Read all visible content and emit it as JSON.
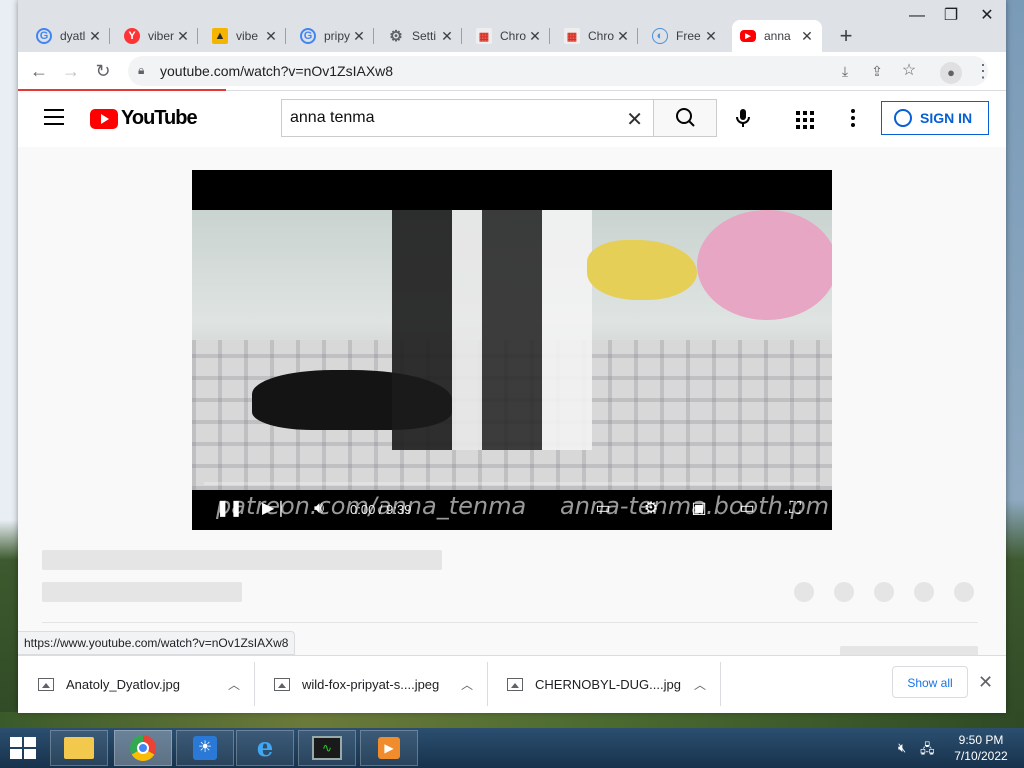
{
  "tabs": [
    {
      "title": "dyatl",
      "icon": "google-icon",
      "color": "#4285f4"
    },
    {
      "title": "viber",
      "icon": "yandex-icon",
      "color": "#ff3333"
    },
    {
      "title": "vibe",
      "icon": "image-icon",
      "color": "#e8a100"
    },
    {
      "title": "pripy",
      "icon": "google-icon",
      "color": "#4285f4"
    },
    {
      "title": "Setti",
      "icon": "gear-icon",
      "color": "#5f6368"
    },
    {
      "title": "Chro",
      "icon": "chrome-store-icon",
      "color": "#d93025"
    },
    {
      "title": "Chro",
      "icon": "chrome-store-icon",
      "color": "#d93025"
    },
    {
      "title": "Free",
      "icon": "blue-circle-icon",
      "color": "#4a90d9"
    },
    {
      "title": "anna",
      "icon": "youtube-icon",
      "color": "#ff0000",
      "active": true
    }
  ],
  "omnibox": {
    "url": "youtube.com/watch?v=nOv1ZsIAXw8"
  },
  "youtube": {
    "logo_text": "YouTube",
    "search_value": "anna tenma",
    "signin_label": "SIGN IN"
  },
  "video": {
    "time": "0:00 / 9:39",
    "watermark_left": "patreon.com/anna_tenma",
    "watermark_right": "anna-tenma.booth.pm",
    "progress": 0
  },
  "status_url": "https://www.youtube.com/watch?v=nOv1ZsIAXw8",
  "downloads": [
    {
      "name": "Anatoly_Dyatlov.jpg"
    },
    {
      "name": "wild-fox-pripyat-s....jpeg"
    },
    {
      "name": "CHERNOBYL-DUG....jpg"
    }
  ],
  "shelf": {
    "show_all": "Show all"
  },
  "taskbar": {
    "time": "9:50 PM",
    "date": "7/10/2022"
  },
  "colors": {
    "accent": "#065fd4",
    "brand": "#ff0000",
    "loading": "#e53935"
  }
}
